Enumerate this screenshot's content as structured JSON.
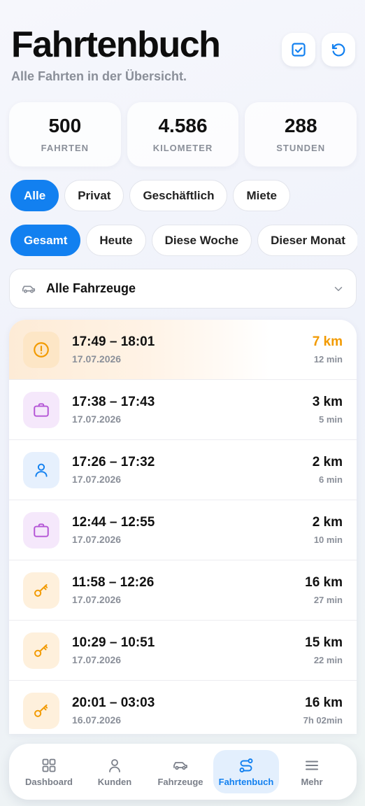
{
  "header": {
    "title": "Fahrtenbuch",
    "subtitle": "Alle Fahrten in der Übersicht.",
    "actions": [
      {
        "icon": "checkbox-icon",
        "color": "#1280f0"
      },
      {
        "icon": "refresh-icon",
        "color": "#1280f0"
      }
    ]
  },
  "stats": [
    {
      "value": "500",
      "label": "FAHRTEN"
    },
    {
      "value": "4.586",
      "label": "KILOMETER"
    },
    {
      "value": "288",
      "label": "STUNDEN"
    }
  ],
  "type_filter": {
    "selected": "Alle",
    "options": [
      "Alle",
      "Privat",
      "Geschäftlich",
      "Miete"
    ]
  },
  "period_filter": {
    "selected": "Gesamt",
    "options": [
      "Gesamt",
      "Heute",
      "Diese Woche",
      "Dieser Monat"
    ]
  },
  "vehicle_select": {
    "value": "Alle Fahrzeuge",
    "icon": "car-icon"
  },
  "trips": [
    {
      "time": "17:49 – 18:01",
      "date": "17.07.2026",
      "km": "7 km",
      "duration": "12 min",
      "icon": "warning-icon",
      "type": "warnung"
    },
    {
      "time": "17:38 – 17:43",
      "date": "17.07.2026",
      "km": "3 km",
      "duration": "5 min",
      "icon": "briefcase-icon",
      "type": "geschäftlich"
    },
    {
      "time": "17:26 – 17:32",
      "date": "17.07.2026",
      "km": "2 km",
      "duration": "6 min",
      "icon": "person-icon",
      "type": "privat"
    },
    {
      "time": "12:44 – 12:55",
      "date": "17.07.2026",
      "km": "2 km",
      "duration": "10 min",
      "icon": "briefcase-icon",
      "type": "geschäftlich"
    },
    {
      "time": "11:58 – 12:26",
      "date": "17.07.2026",
      "km": "16 km",
      "duration": "27 min",
      "icon": "key-icon",
      "type": "miete"
    },
    {
      "time": "10:29 – 10:51",
      "date": "17.07.2026",
      "km": "15 km",
      "duration": "22 min",
      "icon": "key-icon",
      "type": "miete"
    },
    {
      "time": "20:01 – 03:03",
      "date": "16.07.2026",
      "km": "16 km",
      "duration": "7h 02min",
      "icon": "key-icon",
      "type": "miete"
    }
  ],
  "nav": [
    {
      "label": "Dashboard",
      "icon": "dashboard-icon"
    },
    {
      "label": "Kunden",
      "icon": "person-icon"
    },
    {
      "label": "Fahrzeuge",
      "icon": "car-icon"
    },
    {
      "label": "Fahrtenbuch",
      "icon": "route-icon",
      "active": true
    },
    {
      "label": "Mehr",
      "icon": "menu-icon"
    }
  ],
  "colors": {
    "accent": "#1280f0",
    "warning": "#f29a00",
    "business": "#b455d6",
    "private": "#1280f0",
    "rental": "#f29a00"
  }
}
